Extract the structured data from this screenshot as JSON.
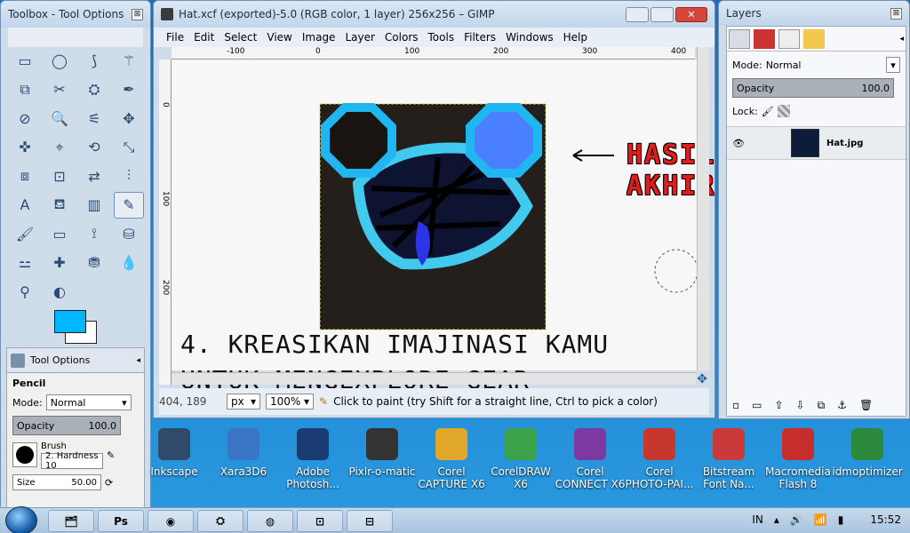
{
  "toolbox": {
    "title": "Toolbox - Tool Options",
    "close": "⊠",
    "tools": [
      "▭",
      "◯",
      "⟆",
      "⚚",
      "⧉",
      "✂",
      "⛭",
      "✒",
      "⊘",
      "🔍",
      "⚟",
      "✥",
      "✜",
      "⌖",
      "⟲",
      "⤡",
      "⧈",
      "⊡",
      "⇄",
      "⫶",
      "A",
      "⛾",
      "▥",
      "✎",
      "🖌",
      "▭",
      "⟟",
      "⛁",
      "⚍",
      "✚",
      "⛃",
      "💧",
      "⚲",
      "◐"
    ],
    "options": {
      "tab_label": "Tool Options",
      "tool_name": "Pencil",
      "mode_label": "Mode:",
      "mode_value": "Normal",
      "opacity_label": "Opacity",
      "opacity_value": "100.0",
      "brush_label": "Brush",
      "brush_value": "2. Hardness 10",
      "size_label": "Size",
      "size_value": "50.00"
    }
  },
  "gimp": {
    "title": "Hat.xcf (exported)-5.0 (RGB color, 1 layer) 256x256 – GIMP",
    "menu": [
      "File",
      "Edit",
      "Select",
      "View",
      "Image",
      "Layer",
      "Colors",
      "Tools",
      "Filters",
      "Windows",
      "Help"
    ],
    "ruler_h": [
      "-100",
      "0",
      "100",
      "200",
      "300",
      "400"
    ],
    "ruler_v": [
      "0",
      "100",
      "200"
    ],
    "status": {
      "coords": "404, 189",
      "unit": "px",
      "zoom": "100%",
      "message": "Click to paint (try Shift for a straight line, Ctrl to pick a color)"
    },
    "annotation_text": "HASIL AKHIR",
    "caption_line1": "4. KREASIKAN IMAJINASI KAMU",
    "caption_line2": "UNTUK MENGEXPLORE GEAR"
  },
  "layers": {
    "title": "Layers",
    "mode_label": "Mode:",
    "mode_value": "Normal",
    "opacity_label": "Opacity",
    "opacity_value": "100.0",
    "lock_label": "Lock:",
    "layer_name": "Hat.jpg"
  },
  "desktop": {
    "icons": [
      {
        "label": "Inkscape",
        "color": "#2f4a6b"
      },
      {
        "label": "Xara3D6",
        "color": "#3a74c4"
      },
      {
        "label": "Adobe Photosh...",
        "color": "#1a3b73"
      },
      {
        "label": "Pixlr-o-matic",
        "color": "#333333"
      },
      {
        "label": "Corel CAPTURE X6",
        "color": "#e1a72b"
      },
      {
        "label": "CorelDRAW X6",
        "color": "#3ba24a"
      },
      {
        "label": "Corel CONNECT X6",
        "color": "#7c3aa1"
      },
      {
        "label": "Corel PHOTO-PAI...",
        "color": "#c8372e"
      },
      {
        "label": "Bitstream Font Na...",
        "color": "#c93b3b"
      },
      {
        "label": "Macromedia Flash 8",
        "color": "#c62e2e"
      },
      {
        "label": "idmoptimizer",
        "color": "#2d8a3d"
      }
    ]
  },
  "taskbar": {
    "items": [
      "🗂",
      "Ps",
      "◉",
      "⛭",
      "◍",
      "⊡",
      "⊟"
    ],
    "lang": "IN",
    "time": "15:52"
  }
}
